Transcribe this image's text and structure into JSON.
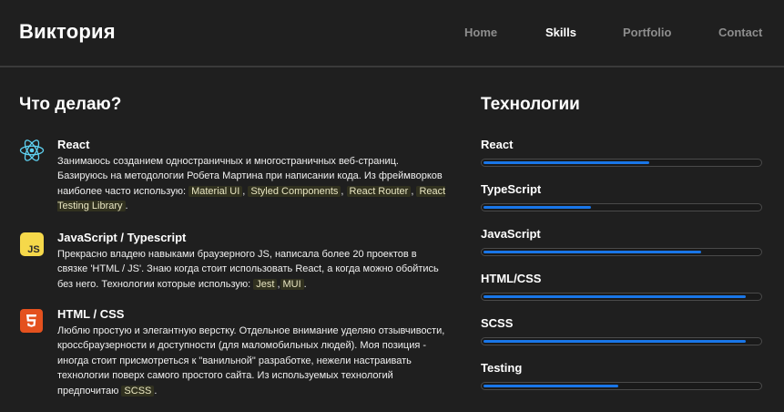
{
  "header": {
    "logo": "Виктория",
    "nav": [
      {
        "label": "Home",
        "active": false
      },
      {
        "label": "Skills",
        "active": true
      },
      {
        "label": "Portfolio",
        "active": false
      },
      {
        "label": "Contact",
        "active": false
      }
    ]
  },
  "left": {
    "heading": "Что делаю?",
    "items": [
      {
        "icon": "react-icon",
        "title": "React",
        "text": "Занимаюсь созданием одностраничных и многостраничных веб-страниц. Базируюсь на методологии Робета Мартина при написании кода. Из фреймворков наиболее часто использую:",
        "tags": [
          "Material UI",
          "Styled Components",
          "React Router",
          "React Testing Library"
        ]
      },
      {
        "icon": "js-icon",
        "title": "JavaScript / Typescript",
        "text": "Прекрасно владею навыками браузерного JS, написала более 20 проектов в связке 'HTML / JS'. Знаю когда стоит использовать React, а когда можно обойтись без него. Технологии которые использую:",
        "tags": [
          "Jest",
          "MUI"
        ]
      },
      {
        "icon": "html5-icon",
        "title": "HTML / CSS",
        "text": "Люблю простую и элегантную верстку. Отдельное внимание уделяю отзывчивости, кроссбраузерности и доступности (для маломобильных людей). Моя позиция - иногда стоит присмотреться к \"ванильной\" разработке, нежели настраивать технологии поверх самого простого сайта. Из используемых технологий предпочитаю",
        "tags": [
          "SCSS"
        ]
      }
    ]
  },
  "right": {
    "heading": "Технологии",
    "skills": [
      {
        "name": "React",
        "level": 0.6
      },
      {
        "name": "TypeScript",
        "level": 0.39
      },
      {
        "name": "JavaScript",
        "level": 0.79
      },
      {
        "name": "HTML/CSS",
        "level": 0.95
      },
      {
        "name": "SCSS",
        "level": 0.95
      },
      {
        "name": "Testing",
        "level": 0.49
      }
    ]
  },
  "colors": {
    "background": "#1f1f1f",
    "accent": "#1976e8",
    "nav_inactive": "#8d8d8d",
    "tag_bg": "#31311f"
  }
}
